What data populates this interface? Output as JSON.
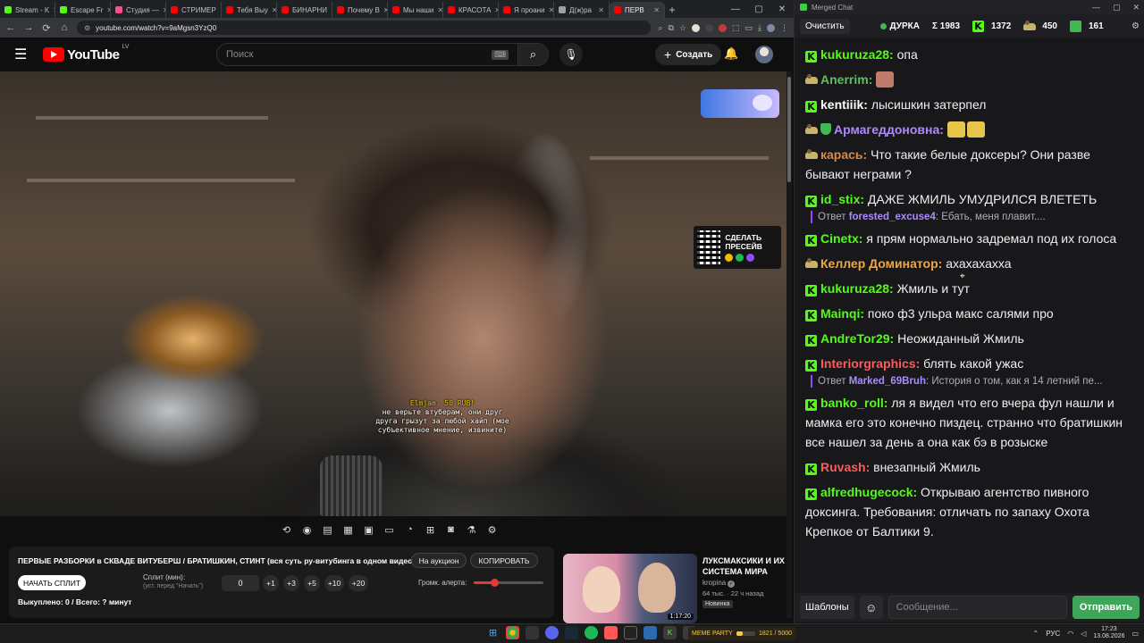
{
  "browser": {
    "tabs": [
      {
        "label": "Stream - K",
        "color": "#53fc18"
      },
      {
        "label": "Escape Fr",
        "color": "#53fc18"
      },
      {
        "label": "Студия —",
        "color": "#ff4e8a"
      },
      {
        "label": "СТРИМЕР",
        "color": "#ff0000"
      },
      {
        "label": "Тебя Выу",
        "color": "#ff0000"
      },
      {
        "label": "БИНАРНИ",
        "color": "#ff0000"
      },
      {
        "label": "Почему В",
        "color": "#ff0000"
      },
      {
        "label": "Мы наши",
        "color": "#ff0000"
      },
      {
        "label": "КРАСОТА",
        "color": "#ff0000"
      },
      {
        "label": "Я проани",
        "color": "#ff0000"
      },
      {
        "label": "Д(ж)ра",
        "color": "#9aa0a6"
      },
      {
        "label": "ПЕРВ",
        "color": "#ff0000",
        "active": true
      }
    ],
    "url": "youtube.com/watch?v=9aMgsn3YzQ0",
    "icons": {
      "back": "←",
      "forward": "→",
      "reload": "⟳",
      "home": "⌂"
    }
  },
  "youtube": {
    "logo_text": "YouTube",
    "region": "LV",
    "search_placeholder": "Поиск",
    "search_kbd": "⌨",
    "create_label": "Создать",
    "accent": "#ff0000"
  },
  "video": {
    "promo_text": "СДЕЛАТЬ ПРЕСЕЙВ",
    "donation_author": "Elmjam. 50 RUB!",
    "donation_text": "не верьте втуберам, они друг друга грызут за любой хайп (мое субъективное мнение, извините)"
  },
  "panel": {
    "title": "ПЕРВЫЕ РАЗБОРКИ в СКВАДЕ ВИТУБЕРШ / БРАТИШКИН, СТИНТ (вся суть ру-витубинга в одном видео)",
    "auction_label": "На аукцион",
    "copy_label": "КОПИРОВАТЬ",
    "start_split_label": "НАЧАТЬ СПЛИТ",
    "split_label": "Сплит (мин):",
    "split_hint": "(уст. перед \"Начать\")",
    "split_value": "0",
    "increments": [
      "+1",
      "+3",
      "+5",
      "+10",
      "+20"
    ],
    "alert_volume_label": "Громк. алерта:",
    "alert_volume_fraction": 0.3,
    "bought_text": "Выкуплено: 0 / Всего: ? минут"
  },
  "recommendation": {
    "title": "ЛУКСМАКСИКИ И ИХ СИСТЕМА МИРА",
    "channel": "kropina",
    "views": "64 тыс.",
    "age": "22 ч назад",
    "badge": "Новинка",
    "duration": "1:17:20"
  },
  "chat": {
    "window_title": "Merged Chat",
    "clear_label": "Очистить",
    "streamer": "ДУРКА",
    "total": "Σ 1983",
    "kick_count": "1372",
    "twitch_count": "450",
    "other_count": "161",
    "messages": [
      {
        "platform": "kick",
        "nick": "kukuruza28",
        "color": "#53fc18",
        "text": "опа"
      },
      {
        "platform": "twitch",
        "nick": "Anerrim",
        "color": "#5fbf5f",
        "text": "",
        "emote": "#c07c6a"
      },
      {
        "platform": "kick",
        "nick": "kentiiik",
        "color": "#ffffff",
        "text": "лысишкин затерпел"
      },
      {
        "platform": "twitch",
        "nick": "Армагеддоновна",
        "color": "#a98bff",
        "text": "",
        "emote": "#e6c54a",
        "shield": true
      },
      {
        "platform": "twitch",
        "nick": "карась",
        "color": "#d58a4a",
        "text": "Что такие белые доксеры? Они разве бывают неграми ?"
      },
      {
        "platform": "kick",
        "nick": "id_stix",
        "color": "#53fc18",
        "text": "ДАЖЕ ЖМИЛЬ УМУДРИЛСЯ ВЛЕТЕТЬ",
        "reply": {
          "label": "Ответ",
          "nick": "forested_excuse4",
          "color": "#a98bff",
          "text": "Ебать, меня плавит...."
        }
      },
      {
        "platform": "kick",
        "nick": "Cinetx",
        "color": "#53fc18",
        "text": "я прям нормально задремал под их голоса"
      },
      {
        "platform": "twitch",
        "nick": "Келлер Доминатор",
        "color": "#f2a541",
        "text": "ахахахахха"
      },
      {
        "platform": "kick",
        "nick": "kukuruza28",
        "color": "#53fc18",
        "text": "Жмиль и тут"
      },
      {
        "platform": "kick",
        "nick": "Mainqi",
        "color": "#53fc18",
        "text": "поко ф3 ульра макс салями про"
      },
      {
        "platform": "kick",
        "nick": "AndreTor29",
        "color": "#53fc18",
        "text": "Неожиданный Жмиль"
      },
      {
        "platform": "kick",
        "nick": "Interiorgraphics",
        "color": "#ff5a5a",
        "text": "блять какой ужас",
        "reply": {
          "label": "Ответ",
          "nick": "Marked_69Bruh",
          "color": "#a98bff",
          "text": "История о том, как я 14 летний пе..."
        }
      },
      {
        "platform": "kick",
        "nick": "banko_roll",
        "color": "#53fc18",
        "text": "ля я видел что его вчера фул нашли и мамка его это конечно пиздец. странно что братишкин все нашел за день а она как бэ в розыске"
      },
      {
        "platform": "kick",
        "nick": "Ruvash",
        "color": "#ff5a5a",
        "text": "внезапный Жмиль"
      },
      {
        "platform": "kick",
        "nick": "alfredhugecock",
        "color": "#53fc18",
        "text": "Открываю агентство пивного доксинга. Требования: отличать по запаху Охота Крепкое от Балтики 9."
      }
    ],
    "templates_label": "Шаблоны",
    "input_placeholder": "Сообщение...",
    "send_label": "Отправить"
  },
  "taskbar": {
    "widget_text": "MEME PARTY",
    "widget_progress": "1821 / 5000",
    "widget_fraction": 0.36,
    "lang": "РУС",
    "time": "17:23",
    "date": "13.08.2026"
  }
}
